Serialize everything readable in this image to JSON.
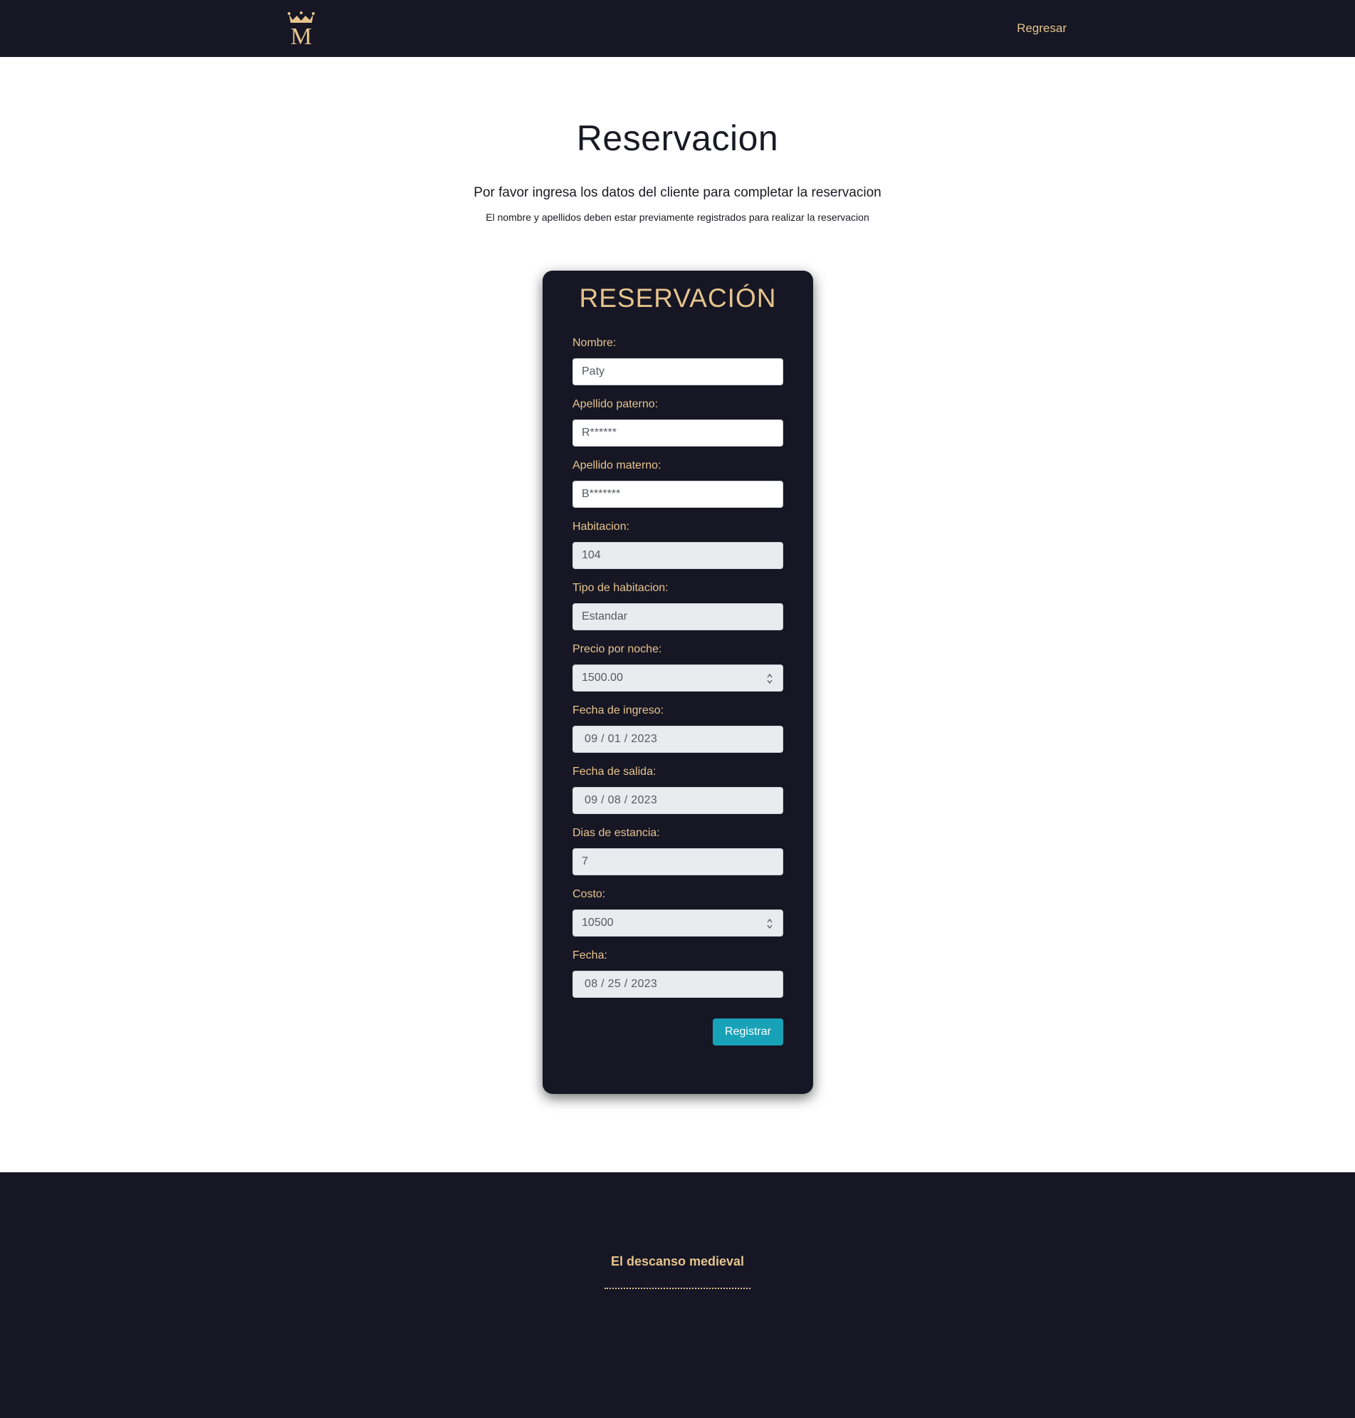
{
  "navbar": {
    "logo_letter": "M",
    "back_link": "Regresar"
  },
  "page": {
    "title": "Reservacion",
    "subtitle": "Por favor ingresa los datos del cliente para completar la reservacion",
    "note": "El nombre y apellidos deben estar previamente registrados para realizar la reservacion"
  },
  "form": {
    "title": "RESERVACIÓN",
    "fields": [
      {
        "label": "Nombre:",
        "value": "Paty"
      },
      {
        "label": "Apellido paterno:",
        "value": "R******"
      },
      {
        "label": "Apellido materno:",
        "value": "B*******"
      },
      {
        "label": "Habitacion:",
        "value": "104"
      },
      {
        "label": "Tipo de habitacion:",
        "value": "Estandar"
      },
      {
        "label": "Precio por noche:",
        "value": "1500.00"
      },
      {
        "label": "Fecha de ingreso:",
        "value": "09 / 01 / 2023"
      },
      {
        "label": "Fecha de salida:",
        "value": "09 / 08 / 2023"
      },
      {
        "label": "Dias de estancia:",
        "value": "7"
      },
      {
        "label": "Costo:",
        "value": "10500"
      },
      {
        "label": "Fecha:",
        "value": "08 / 25 / 2023"
      }
    ],
    "submit_label": "Registrar"
  },
  "footer": {
    "title": "El descanso medieval"
  },
  "colors": {
    "dark": "#161624",
    "gold": "#e6c48d",
    "accent": "#17a2b8",
    "readonly_bg": "#e9ecef"
  }
}
